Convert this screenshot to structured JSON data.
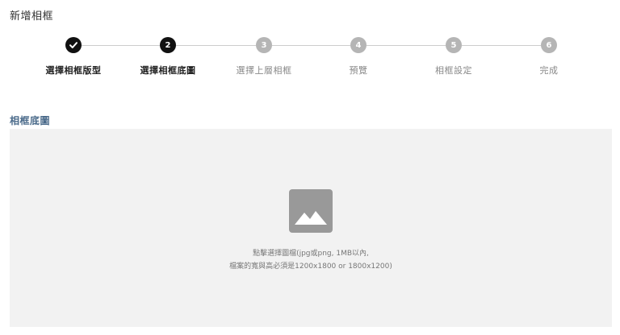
{
  "page": {
    "title": "新增相框"
  },
  "stepper": {
    "steps": [
      {
        "number": "",
        "label": "選擇相框版型",
        "status": "done",
        "icon": "check-icon"
      },
      {
        "number": "2",
        "label": "選擇相框底圖",
        "status": "active"
      },
      {
        "number": "3",
        "label": "選擇上層相框",
        "status": "pending"
      },
      {
        "number": "4",
        "label": "預覽",
        "status": "pending"
      },
      {
        "number": "5",
        "label": "相框設定",
        "status": "pending"
      },
      {
        "number": "6",
        "label": "完成",
        "status": "pending"
      }
    ],
    "colors": {
      "done": "#111111",
      "active": "#111111",
      "pending": "#b5b5b5",
      "line": "#cccccc"
    }
  },
  "section": {
    "title": "相框底圖",
    "title_color": "#4a6a8a"
  },
  "upload": {
    "icon": "image-placeholder-icon",
    "hint_line1": "點擊選擇圖檔(jpg或png, 1MB以內,",
    "hint_line2": "檔案的寬與高必須是1200x1800 or 1800x1200)",
    "background": "#f2f2f2"
  }
}
